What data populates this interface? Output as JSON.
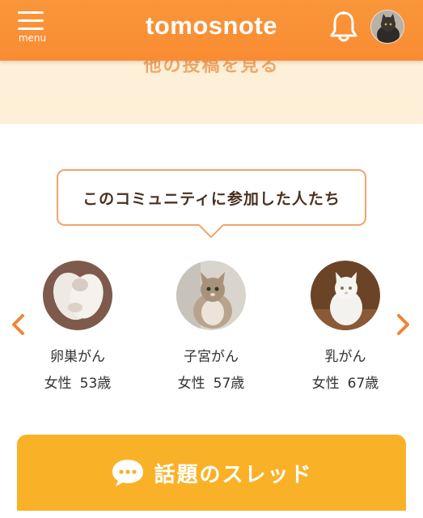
{
  "header": {
    "menu_label": "menu",
    "logo": "tomosnote",
    "bell_icon": "bell-icon",
    "avatar_icon": "user-avatar-cat"
  },
  "previous_section": {
    "see_more": "他の投稿を見る"
  },
  "members_section": {
    "title": "このコミュニティに参加した人たち",
    "members": [
      {
        "name": "卵巣がん",
        "gender": "女性",
        "age": "53歳"
      },
      {
        "name": "子宮がん",
        "gender": "女性",
        "age": "57歳"
      },
      {
        "name": "乳がん",
        "gender": "女性",
        "age": "67歳"
      }
    ]
  },
  "threads_section": {
    "title": "話題のスレッド",
    "icon": "chat-bubble-icon"
  },
  "colors": {
    "header": "#f98c33",
    "peach": "#fdefd8",
    "bubble_border": "#f3a36a",
    "arrow": "#f0853a",
    "thread_bg": "#f9b228"
  }
}
